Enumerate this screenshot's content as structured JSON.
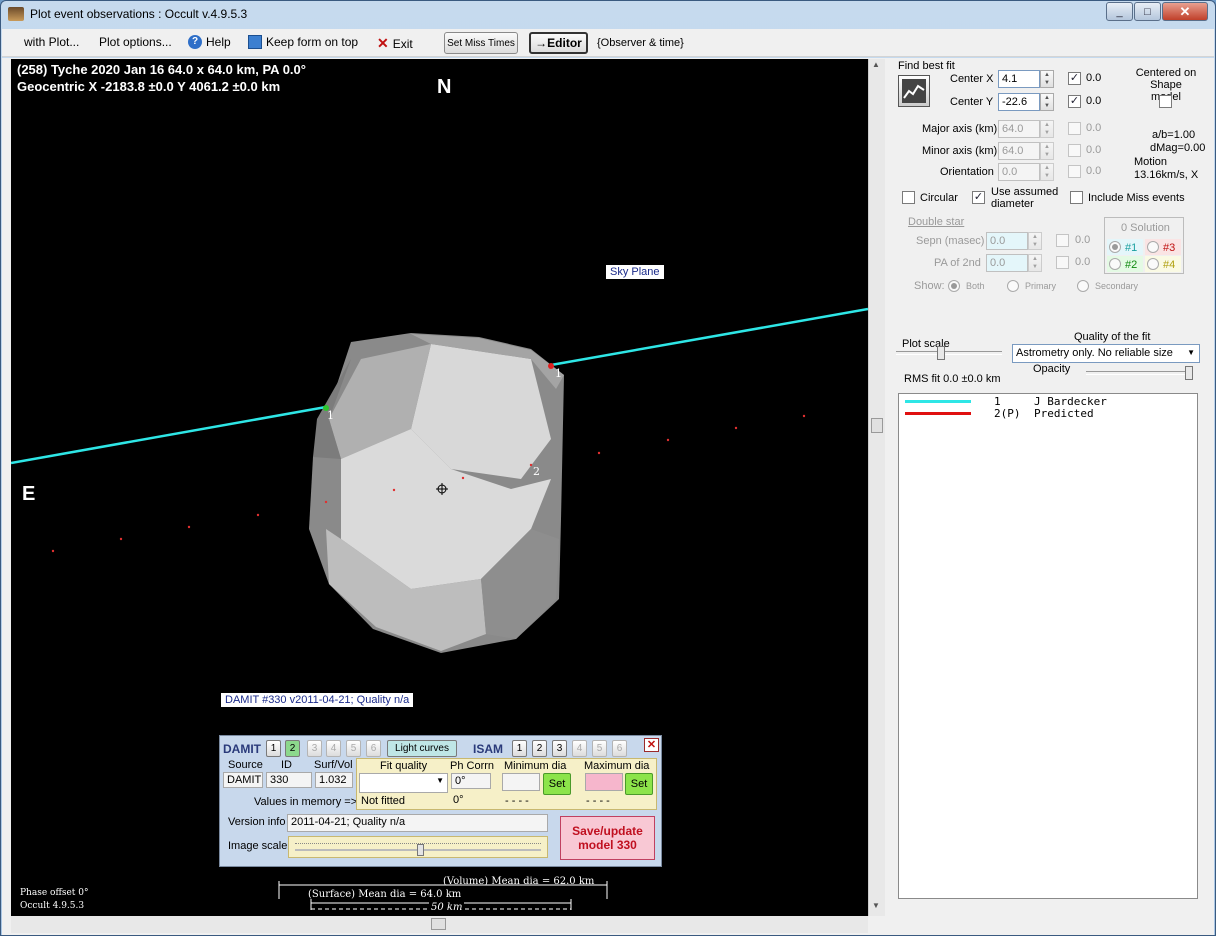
{
  "window": {
    "title": "Plot event observations : Occult v.4.9.5.3",
    "min": "_",
    "max": "□",
    "close": "✕"
  },
  "menu": {
    "with_plot": "with Plot...",
    "plot_options": "Plot options...",
    "help": "Help",
    "keep_on_top": "Keep form on top",
    "exit": "Exit",
    "set_miss_times": "Set Miss Times",
    "editor": "→Editor",
    "observer_time": "{Observer & time}"
  },
  "plot": {
    "header_line1": "(258) Tyche  2020 Jan 16   64.0 x 64.0 km, PA 0.0°",
    "header_line2": "Geocentric  X  -2183.8 ±0.0  Y 4061.2 ±0.0 km",
    "north": "N",
    "east": "E",
    "sky_plane": "Sky Plane",
    "chord_label_a": "1",
    "chord_label_b": "1",
    "chord_label_c": "2",
    "damit_label": "DAMIT #330 v2011-04-21; Quality n/a",
    "phase_offset": "Phase offset 0°",
    "version": "Occult 4.9.5.3",
    "volume_dia": "(Volume) Mean dia = 62.0 km",
    "surface_dia": "(Surface) Mean dia = 64.0 km",
    "scale_bar": "50 km",
    "chord_color": "#2ee6e6"
  },
  "damit": {
    "title": "DAMIT",
    "buttons": [
      "1",
      "2",
      "3",
      "4",
      "5",
      "6"
    ],
    "light_curves": "Light curves",
    "isam": "ISAM",
    "isam_buttons": [
      "1",
      "2",
      "3",
      "4",
      "5",
      "6"
    ],
    "col_source": "Source",
    "col_id": "ID",
    "col_surfvol": "Surf/Vol",
    "source": "DAMIT",
    "id": "330",
    "surfvol": "1.032",
    "values_in_memory": "Values in memory =>",
    "fit_quality": "Fit quality",
    "ph_corrn": "Ph Corrn",
    "min_dia": "Minimum dia",
    "max_dia": "Maximum dia",
    "ph_val": "0°",
    "not_fitted": "Not fitted",
    "ph_mem": "0°",
    "min_mem": "- - - -",
    "max_mem": "- - - -",
    "set": "Set",
    "version_info_label": "Version info",
    "version_info": "2011-04-21; Quality n/a",
    "image_scale": "Image scale",
    "save_update": "Save/update model 330"
  },
  "panel": {
    "find_best_fit": "Find best fit",
    "center_x_label": "Center X",
    "center_x": "4.1",
    "center_x_err": "0.0",
    "center_y_label": "Center Y",
    "center_y": "-22.6",
    "center_y_err": "0.0",
    "centered_on": "Centered on Shape model",
    "major_label": "Major axis (km)",
    "major": "64.0",
    "major_err": "0.0",
    "minor_label": "Minor axis (km)",
    "minor": "64.0",
    "minor_err": "0.0",
    "orient_label": "Orientation",
    "orient": "0.0",
    "orient_err": "0.0",
    "ab": "a/b=1.00",
    "dmag": "dMag=0.00",
    "motion": "Motion",
    "motion_val": "13.16km/s, X",
    "circular": "Circular",
    "use_assumed": "Use assumed diameter",
    "include_miss": "Include Miss events",
    "double_star": "Double star",
    "sepn_label": "Sepn (masec)",
    "sepn": "0.0",
    "sepn_err": "0.0",
    "pa2_label": "PA of 2nd",
    "pa2": "0.0",
    "pa2_err": "0.0",
    "show": "Show:",
    "both": "Both",
    "primary": "Primary",
    "secondary": "Secondary",
    "zero_solution": "0 Solution",
    "sol1": "#1",
    "sol2": "#2",
    "sol3": "#3",
    "sol4": "#4",
    "plot_scale": "Plot scale",
    "quality_label": "Quality of the fit",
    "quality_value": "Astrometry only. No reliable size",
    "opacity": "Opacity",
    "rms": "RMS fit 0.0 ±0.0 km",
    "legend": [
      {
        "num": "1",
        "name": "J Bardecker",
        "color": "#2ee6e6"
      },
      {
        "num": "2(P)",
        "name": "Predicted",
        "color": "#e01010"
      }
    ]
  }
}
